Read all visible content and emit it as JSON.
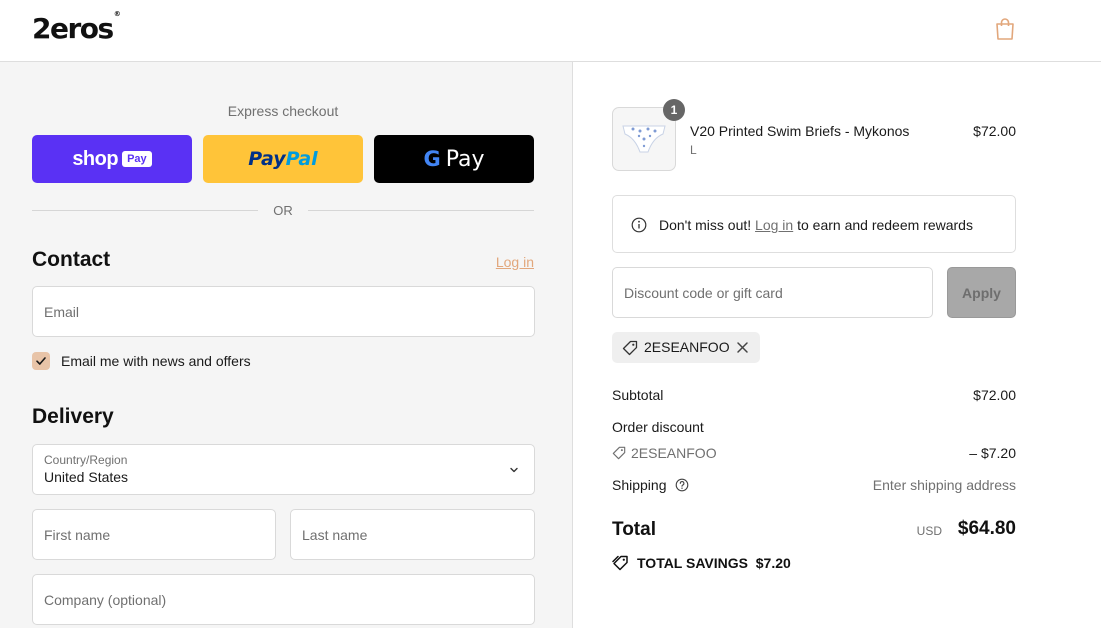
{
  "header": {
    "logo": "2eros",
    "logo_mark": "®",
    "cart_icon": "shopping-bag-icon"
  },
  "express": {
    "title": "Express checkout",
    "shop_label": "shop",
    "shop_pay_label": "Pay",
    "paypal_part1": "Pay",
    "paypal_part2": "Pal",
    "gpay_g": "G",
    "gpay_label": "Pay",
    "or_label": "OR"
  },
  "contact": {
    "title": "Contact",
    "login_label": "Log in",
    "email_placeholder": "Email",
    "newsletter_label": "Email me with news and offers",
    "newsletter_checked": true
  },
  "delivery": {
    "title": "Delivery",
    "country_label": "Country/Region",
    "country_value": "United States",
    "first_name_placeholder": "First name",
    "last_name_placeholder": "Last name",
    "company_placeholder": "Company (optional)"
  },
  "order": {
    "item": {
      "quantity": "1",
      "name": "V20 Printed Swim Briefs - Mykonos",
      "variant": "L",
      "price": "$72.00"
    },
    "rewards": {
      "text_before": "Don't miss out!",
      "link": "Log in",
      "text_after": "to earn and redeem rewards"
    },
    "discount": {
      "placeholder": "Discount code or gift card",
      "apply_label": "Apply",
      "applied_code": "2ESEANFOO"
    },
    "summary": {
      "subtotal_label": "Subtotal",
      "subtotal_value": "$72.00",
      "discount_label": "Order discount",
      "discount_code": "2ESEANFOO",
      "discount_value": "– $7.20",
      "shipping_label": "Shipping",
      "shipping_value": "Enter shipping address",
      "total_label": "Total",
      "currency": "USD",
      "total_value": "$64.80",
      "savings_label": "TOTAL SAVINGS",
      "savings_value": "$7.20"
    }
  },
  "colors": {
    "shop_pay": "#5a31f4",
    "paypal": "#ffc439",
    "gpay": "#000000",
    "accent_link": "#e2a77c",
    "checkbox": "#e8c4a8"
  }
}
